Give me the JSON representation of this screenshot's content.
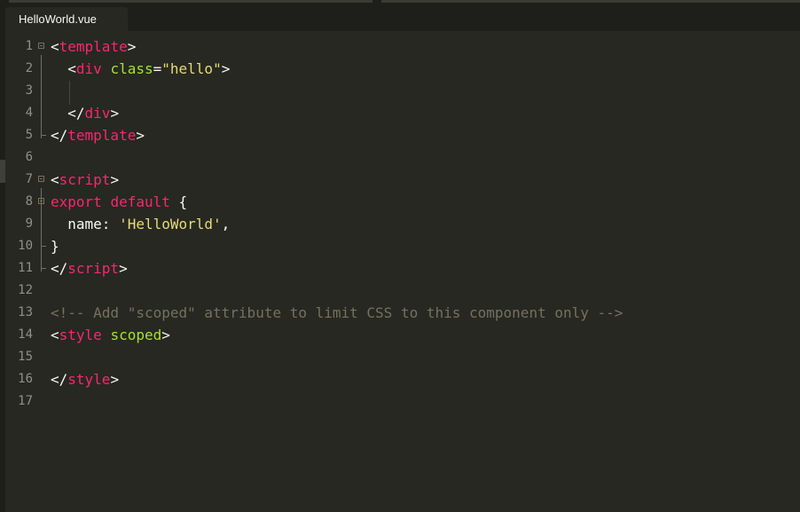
{
  "tab": {
    "label": "HelloWorld.vue"
  },
  "colors": {
    "background": "#272822",
    "tag": "#f92672",
    "attribute": "#a6e22e",
    "string": "#e6db74",
    "comment": "#75715e",
    "text": "#f8f8f2",
    "gutter": "#8f908a"
  },
  "lines": [
    {
      "num": "1",
      "fold": "start",
      "tokens": [
        [
          "punc",
          "<"
        ],
        [
          "tag",
          "template"
        ],
        [
          "punc",
          ">"
        ]
      ]
    },
    {
      "num": "2",
      "fold": "body",
      "tokens": [
        [
          "punc",
          "  <"
        ],
        [
          "tag",
          "div"
        ],
        [
          "punc",
          " "
        ],
        [
          "attr",
          "class"
        ],
        [
          "punc",
          "="
        ],
        [
          "str",
          "\"hello\""
        ],
        [
          "punc",
          ">"
        ]
      ]
    },
    {
      "num": "3",
      "fold": "body",
      "tokens": []
    },
    {
      "num": "4",
      "fold": "body",
      "tokens": [
        [
          "punc",
          "  </"
        ],
        [
          "tag",
          "div"
        ],
        [
          "punc",
          ">"
        ]
      ]
    },
    {
      "num": "5",
      "fold": "end",
      "tokens": [
        [
          "punc",
          "</"
        ],
        [
          "tag",
          "template"
        ],
        [
          "punc",
          ">"
        ]
      ]
    },
    {
      "num": "6",
      "fold": "",
      "tokens": []
    },
    {
      "num": "7",
      "fold": "start",
      "tokens": [
        [
          "punc",
          "<"
        ],
        [
          "tag",
          "script"
        ],
        [
          "punc",
          ">"
        ]
      ]
    },
    {
      "num": "8",
      "fold": "start",
      "tokens": [
        [
          "tag",
          "export"
        ],
        [
          "punc",
          " "
        ],
        [
          "tag",
          "default"
        ],
        [
          "punc",
          " {"
        ]
      ]
    },
    {
      "num": "9",
      "fold": "body",
      "tokens": [
        [
          "punc",
          "  name: "
        ],
        [
          "str",
          "'HelloWorld'"
        ],
        [
          "punc",
          ","
        ]
      ]
    },
    {
      "num": "10",
      "fold": "end",
      "tokens": [
        [
          "punc",
          "}"
        ]
      ]
    },
    {
      "num": "11",
      "fold": "end",
      "tokens": [
        [
          "punc",
          "</"
        ],
        [
          "tag",
          "script"
        ],
        [
          "punc",
          ">"
        ]
      ]
    },
    {
      "num": "12",
      "fold": "",
      "tokens": []
    },
    {
      "num": "13",
      "fold": "",
      "tokens": [
        [
          "comment",
          "<!-- Add \"scoped\" attribute to limit CSS to this component only -->"
        ]
      ]
    },
    {
      "num": "14",
      "fold": "",
      "tokens": [
        [
          "punc",
          "<"
        ],
        [
          "tag",
          "style"
        ],
        [
          "punc",
          " "
        ],
        [
          "attr",
          "scoped"
        ],
        [
          "punc",
          ">"
        ]
      ]
    },
    {
      "num": "15",
      "fold": "",
      "tokens": []
    },
    {
      "num": "16",
      "fold": "",
      "tokens": [
        [
          "punc",
          "</"
        ],
        [
          "tag",
          "style"
        ],
        [
          "punc",
          ">"
        ]
      ]
    },
    {
      "num": "17",
      "fold": "",
      "tokens": []
    }
  ]
}
